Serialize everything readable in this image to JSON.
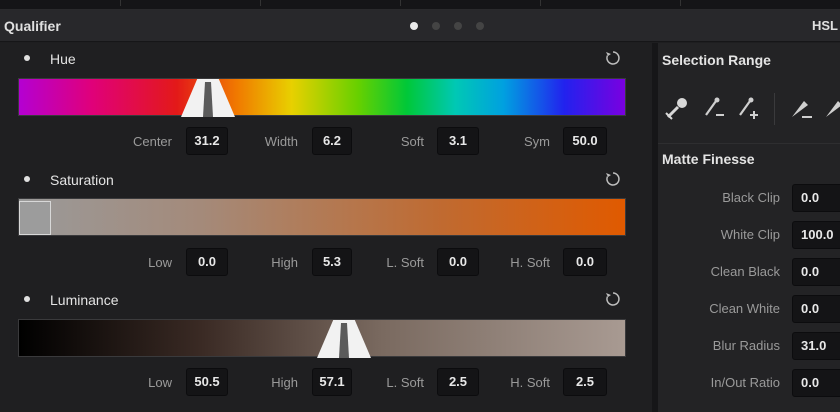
{
  "panel": {
    "title": "Qualifier",
    "mode_tab": "HSL",
    "page_dots": 4,
    "active_dot": 0
  },
  "hue": {
    "label": "Hue",
    "center_label": "Center",
    "center": "31.2",
    "width_label": "Width",
    "width": "6.2",
    "soft_label": "Soft",
    "soft": "3.1",
    "sym_label": "Sym",
    "sym": "50.0"
  },
  "saturation": {
    "label": "Saturation",
    "low_label": "Low",
    "low": "0.0",
    "high_label": "High",
    "high": "5.3",
    "lsoft_label": "L. Soft",
    "lsoft": "0.0",
    "hsoft_label": "H. Soft",
    "hsoft": "0.0"
  },
  "luminance": {
    "label": "Luminance",
    "low_label": "Low",
    "low": "50.5",
    "high_label": "High",
    "high": "57.1",
    "lsoft_label": "L. Soft",
    "lsoft": "2.5",
    "hsoft_label": "H. Soft",
    "hsoft": "2.5"
  },
  "selection_range": {
    "title": "Selection Range",
    "tools": [
      "picker-icon",
      "picker-minus-icon",
      "picker-plus-icon",
      "feather-minus-icon",
      "feather-plus-icon"
    ]
  },
  "matte_finesse": {
    "title": "Matte Finesse",
    "rows": [
      {
        "label": "Black Clip",
        "value": "0.0"
      },
      {
        "label": "White Clip",
        "value": "100.0"
      },
      {
        "label": "Clean Black",
        "value": "0.0"
      },
      {
        "label": "Clean White",
        "value": "0.0"
      },
      {
        "label": "Blur Radius",
        "value": "31.0"
      },
      {
        "label": "In/Out Ratio",
        "value": "0.0"
      }
    ]
  },
  "colors": {
    "bg": "#1f1f21",
    "field_bg": "#141416",
    "handle": "#f2f2f2",
    "sat_end": "#e05a00"
  }
}
